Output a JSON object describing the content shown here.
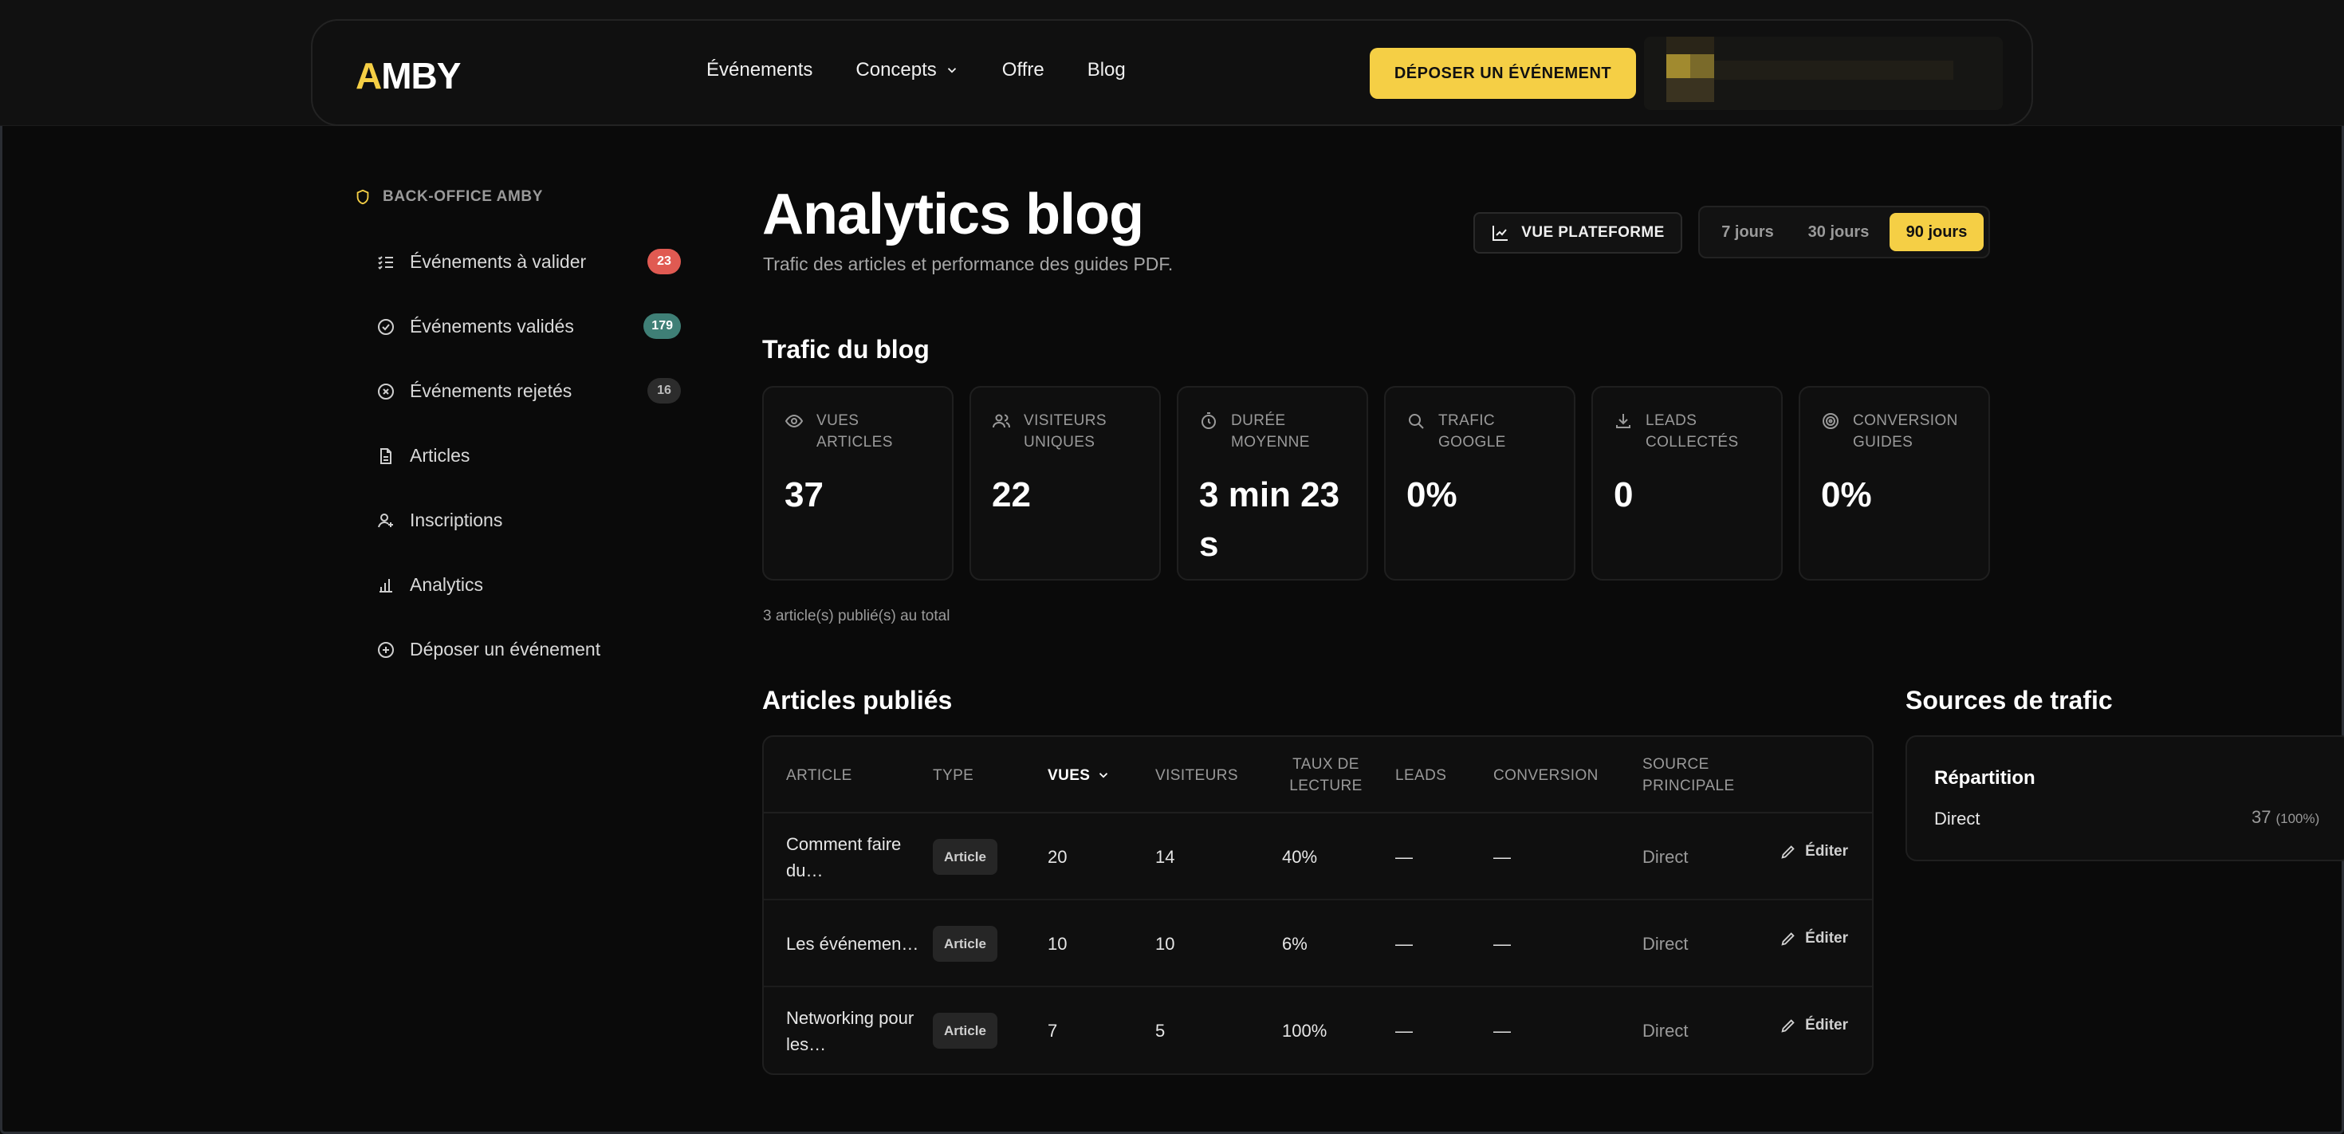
{
  "header": {
    "logo_first": "A",
    "logo_rest": "MBY",
    "nav": [
      "Événements",
      "Concepts",
      "Offre",
      "Blog"
    ],
    "cta": "DÉPOSER UN ÉVÉNEMENT"
  },
  "sidebar": {
    "heading": "BACK-OFFICE AMBY",
    "items": [
      {
        "label": "Événements à valider",
        "badge": "23",
        "badge_color": "#e05a52",
        "icon": "checklist-icon"
      },
      {
        "label": "Événements validés",
        "badge": "179",
        "badge_color": "#3f7f76",
        "icon": "check-circle-icon"
      },
      {
        "label": "Événements rejetés",
        "badge": "16",
        "badge_color": "#2c2c2c",
        "icon": "x-circle-icon"
      },
      {
        "label": "Articles",
        "icon": "document-icon"
      },
      {
        "label": "Inscriptions",
        "icon": "user-plus-icon"
      },
      {
        "label": "Analytics",
        "icon": "bar-chart-icon"
      },
      {
        "label": "Déposer un événement",
        "icon": "plus-circle-icon"
      }
    ]
  },
  "page": {
    "title": "Analytics blog",
    "subtitle": "Trafic des articles et performance des guides PDF.",
    "vue_plateforme": "VUE PLATEFORME",
    "periods": [
      "7 jours",
      "30 jours",
      "90 jours"
    ],
    "active_period": "90 jours"
  },
  "traffic": {
    "title": "Trafic du blog",
    "kpis": [
      {
        "label": "VUES ARTICLES",
        "value": "37",
        "icon": "eye-icon"
      },
      {
        "label": "VISITEURS UNIQUES",
        "value": "22",
        "icon": "users-icon"
      },
      {
        "label": "DURÉE MOYENNE",
        "value": "3 min 23 s",
        "icon": "stopwatch-icon"
      },
      {
        "label": "TRAFIC GOOGLE",
        "value": "0%",
        "icon": "search-icon"
      },
      {
        "label": "LEADS COLLECTÉS",
        "value": "0",
        "icon": "download-icon"
      },
      {
        "label": "CONVERSION GUIDES",
        "value": "0%",
        "icon": "target-icon"
      }
    ],
    "total_note": "3 article(s) publié(s) au total"
  },
  "articles": {
    "title": "Articles publiés",
    "columns": [
      "ARTICLE",
      "TYPE",
      "VUES",
      "VISITEURS",
      "TAUX DE LECTURE",
      "LEADS",
      "CONVERSION",
      "SOURCE PRINCIPALE"
    ],
    "sorted_column": "VUES",
    "edit_label": "Éditer",
    "rows": [
      {
        "article": "Comment faire du…",
        "type": "Article",
        "vues": "20",
        "visiteurs": "14",
        "taux": "40%",
        "leads": "—",
        "conversion": "—",
        "source": "Direct"
      },
      {
        "article": "Les événemen…",
        "type": "Article",
        "vues": "10",
        "visiteurs": "10",
        "taux": "6%",
        "leads": "—",
        "conversion": "—",
        "source": "Direct"
      },
      {
        "article": "Networking pour les…",
        "type": "Article",
        "vues": "7",
        "visiteurs": "5",
        "taux": "100%",
        "leads": "—",
        "conversion": "—",
        "source": "Direct"
      }
    ]
  },
  "sources": {
    "title": "Sources de trafic",
    "card_title": "Répartition",
    "items": [
      {
        "name": "Direct",
        "value": "37",
        "pct": "(100%)"
      }
    ]
  }
}
